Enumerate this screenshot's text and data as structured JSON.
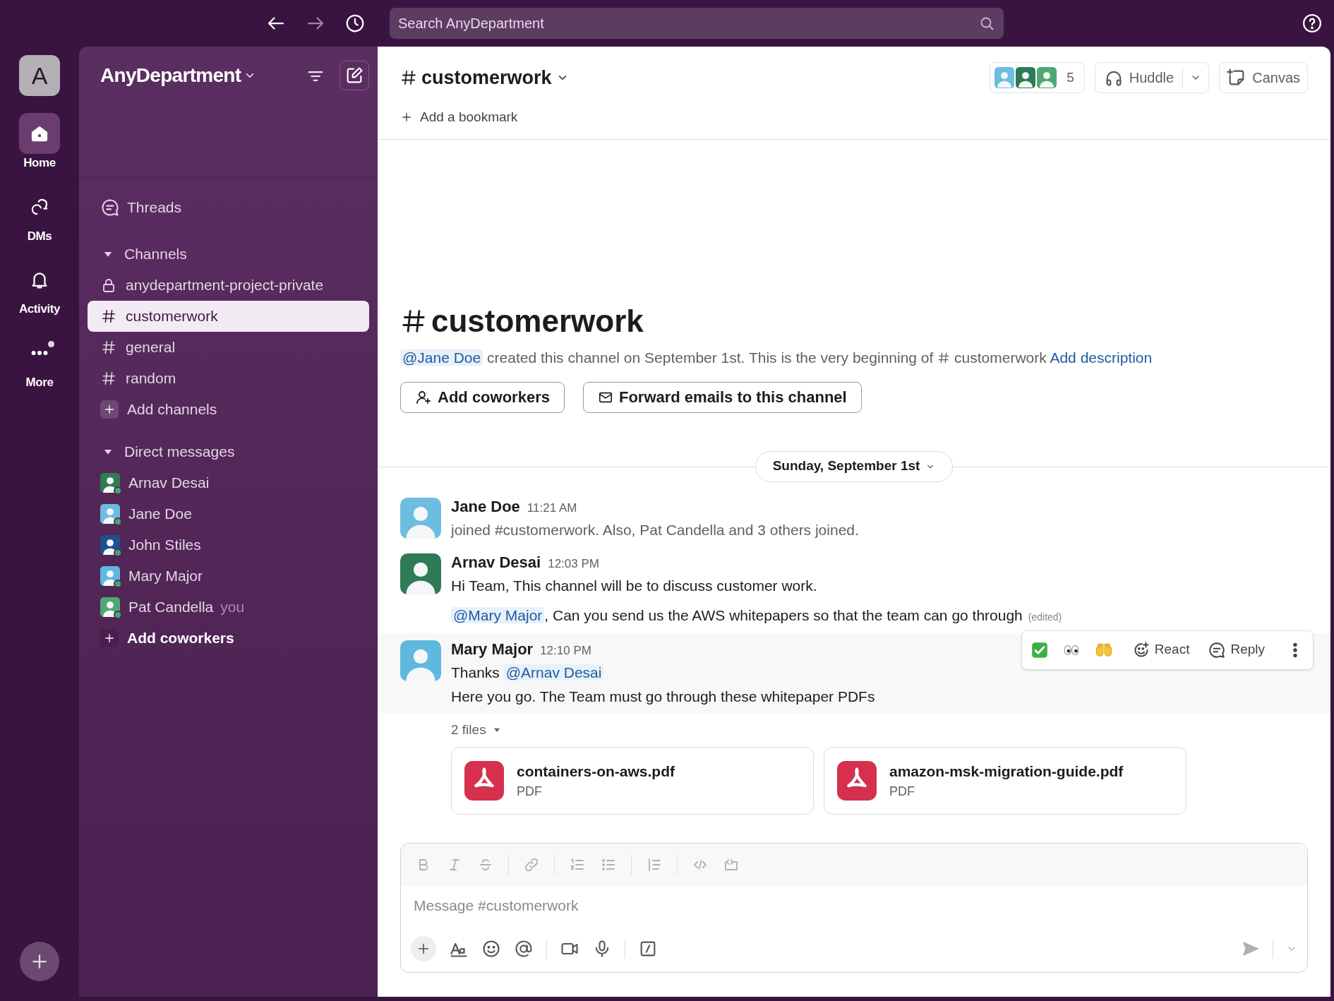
{
  "top_bar": {
    "search_placeholder": "Search AnyDepartment"
  },
  "rail": {
    "workspace_initial": "A",
    "items": [
      {
        "label": "Home",
        "selected": true,
        "unread": false
      },
      {
        "label": "DMs",
        "selected": false,
        "unread": false
      },
      {
        "label": "Activity",
        "selected": false,
        "unread": false
      },
      {
        "label": "More",
        "selected": false,
        "unread": true
      }
    ]
  },
  "sidebar": {
    "workspace": "AnyDepartment",
    "threads": "Threads",
    "sections": [
      {
        "title": "Channels",
        "expanded": true,
        "items": [
          {
            "kind": "private",
            "label": "anydepartment-project-private",
            "selected": false
          },
          {
            "kind": "channel",
            "label": "customerwork",
            "selected": true
          },
          {
            "kind": "channel",
            "label": "general",
            "selected": false
          },
          {
            "kind": "channel",
            "label": "random",
            "selected": false
          },
          {
            "kind": "add",
            "label": "Add channels",
            "selected": false
          }
        ]
      },
      {
        "title": "Direct messages",
        "expanded": true,
        "items": [
          {
            "kind": "dm",
            "label": "Arnav Desai",
            "color": "#2f7a57",
            "online": true,
            "selected": false
          },
          {
            "kind": "dm",
            "label": "Jane Doe",
            "color": "#6cbde0",
            "online": true,
            "selected": false
          },
          {
            "kind": "dm",
            "label": "John Stiles",
            "color": "#1f4f8f",
            "online": true,
            "selected": false
          },
          {
            "kind": "dm",
            "label": "Mary Major",
            "color": "#5fb8de",
            "online": true,
            "selected": false
          },
          {
            "kind": "dm",
            "label": "Pat Candella",
            "suffix": "you",
            "color": "#4fa874",
            "online": true,
            "selected": false
          },
          {
            "kind": "add_bold",
            "label": "Add coworkers",
            "selected": false
          }
        ]
      }
    ]
  },
  "channel": {
    "name": "customerwork",
    "member_count": "5",
    "members": [
      {
        "color": "#6cbde0"
      },
      {
        "color": "#2f7a57"
      },
      {
        "color": "#4fa874"
      }
    ],
    "huddle": "Huddle",
    "canvas": "Canvas",
    "bookmark": "Add a bookmark"
  },
  "intro": {
    "title": "customerwork",
    "mention": "@Jane Doe",
    "text": "created this channel on September 1st. This is the very beginning of",
    "channel_ref": "customerwork",
    "link": "Add description",
    "buttons": [
      {
        "kind": "add_people",
        "label": "Add coworkers"
      },
      {
        "kind": "email",
        "label": "Forward emails to this channel"
      }
    ]
  },
  "date_divider": "Sunday, September 1st",
  "messages": [
    {
      "author": "Jane Doe",
      "time": "11:21 AM",
      "color": "#6cbde0",
      "highlighted": false,
      "lines": [
        [
          {
            "kind": "muted",
            "text": "joined #customerwork. Also, Pat Candella and 3 others joined."
          }
        ]
      ]
    },
    {
      "author": "Arnav Desai",
      "time": "12:03 PM",
      "color": "#2f7a57",
      "highlighted": false,
      "lines": [
        [
          {
            "kind": "text",
            "text": "Hi Team, This channel will be to discuss customer work."
          }
        ],
        [
          {
            "kind": "mention",
            "text": "@Mary Major"
          },
          {
            "kind": "text",
            "text": ", Can you send us the AWS whitepapers so that the team can go through"
          },
          {
            "kind": "edited",
            "text": "(edited)"
          }
        ]
      ]
    },
    {
      "author": "Mary Major",
      "time": "12:10 PM",
      "color": "#5fb8de",
      "highlighted": true,
      "lines": [
        [
          {
            "kind": "text",
            "text": "Thanks "
          },
          {
            "kind": "mention",
            "text": "@Arnav Desai"
          }
        ],
        [
          {
            "kind": "text",
            "text": "Here you go. The Team must go through these whitepaper PDFs"
          }
        ]
      ]
    }
  ],
  "hover_toolbar": {
    "react": "React",
    "reply": "Reply"
  },
  "files": {
    "label": "2 files",
    "items": [
      {
        "name": "containers-on-aws.pdf",
        "type": "PDF"
      },
      {
        "name": "amazon-msk-migration-guide.pdf",
        "type": "PDF"
      }
    ]
  },
  "composer": {
    "placeholder": "Message #customerwork"
  }
}
